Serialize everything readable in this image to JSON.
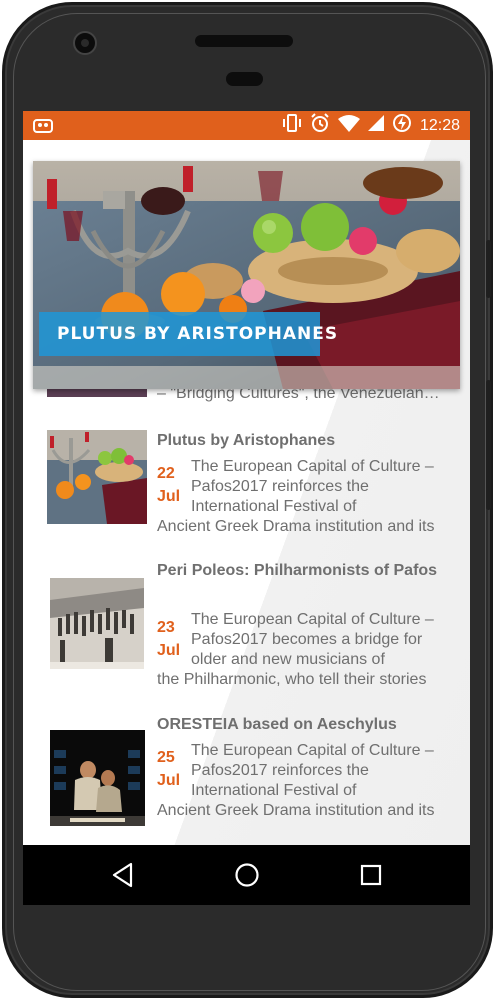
{
  "status_bar": {
    "time": "12:28",
    "icons": [
      "app-notification-icon",
      "vibrate-icon",
      "alarm-icon",
      "wifi-icon",
      "signal-icon",
      "battery-charging-icon"
    ]
  },
  "hero": {
    "title": "PLUTUS BY ARISTOPHANES"
  },
  "peek_item": {
    "description": "– \"Bridging Cultures\", the Venezuelan Philharmonic"
  },
  "articles": [
    {
      "title": "Plutus by Aristophanes",
      "day": "22",
      "month": "Jul",
      "description": "The European Capital of Culture – Pafos2017 reinforces the International Festival of",
      "description_last": "Ancient Greek Drama institution and its"
    },
    {
      "title": "Peri Poleos: Philharmonists of Pafos",
      "day": "23",
      "month": "Jul",
      "description": "The European Capital of Culture – Pafos2017 becomes a bridge for older and new musicians of",
      "description_last": "the Philharmonic, who tell their stories"
    },
    {
      "title": "ORESTEIA based on Aeschylus",
      "day": "25",
      "month": "Jul",
      "description": "The European Capital of Culture – Pafos2017 reinforces the International Festival of",
      "description_last": "Ancient Greek Drama institution and its"
    }
  ],
  "colors": {
    "accent": "#e0601c",
    "hero_label": "#1e96d7",
    "text_gray": "#6f6f6f",
    "navbar": "#000000"
  },
  "nav": [
    "back-icon",
    "home-icon",
    "recents-icon"
  ]
}
